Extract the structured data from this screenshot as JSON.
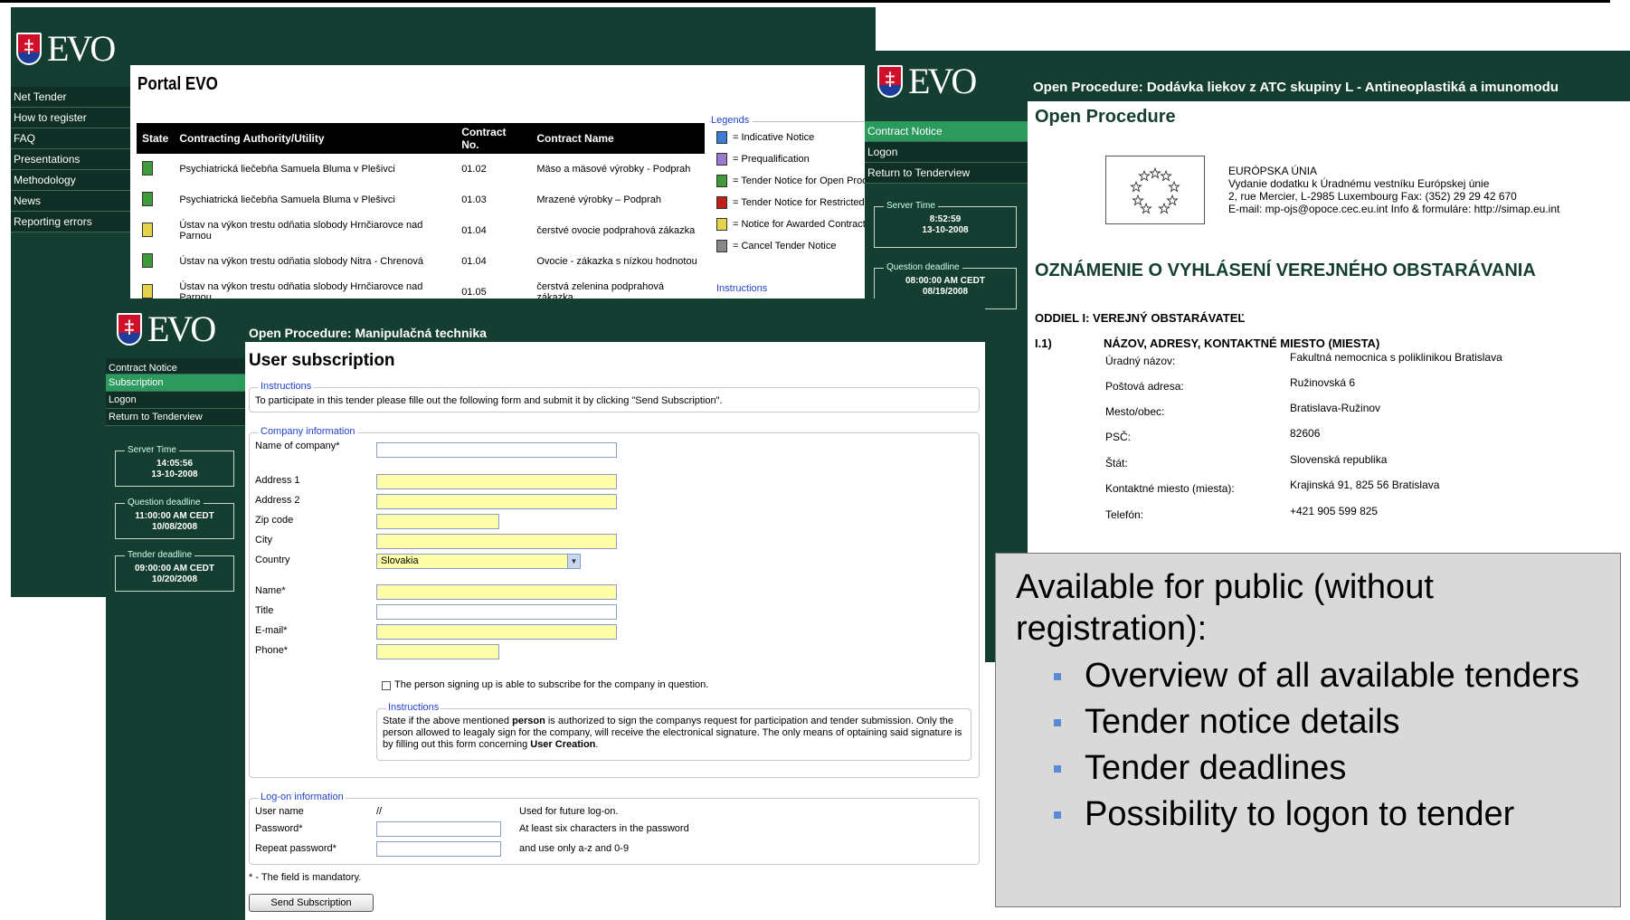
{
  "brand": {
    "logo_text": "EVO"
  },
  "portal": {
    "title": "Portal EVO",
    "menu": [
      "Net Tender",
      "How to register",
      "FAQ",
      "Presentations",
      "Methodology",
      "News",
      "Reporting errors"
    ],
    "table": {
      "headers": [
        "State",
        "Contracting Authority/Utility",
        "Contract No.",
        "Contract Name"
      ],
      "rows": [
        {
          "state": "green",
          "authority": "Psychiatrická liečebňa Samuela Bluma v Plešivci",
          "no": "01.02",
          "name": "Mäso a mäsové výrobky - Podprah"
        },
        {
          "state": "green",
          "authority": "Psychiatrická liečebňa Samuela Bluma v Plešivci",
          "no": "01.03",
          "name": "Mrazené výrobky – Podprah"
        },
        {
          "state": "yellow",
          "authority": "Ústav na výkon trestu odňatia slobody Hrnčiarovce nad Parnou",
          "no": "01.04",
          "name": "čerstvé ovocie podprahová zákazka"
        },
        {
          "state": "green",
          "authority": "Ústav na výkon trestu odňatia slobody Nitra - Chrenová",
          "no": "01.04",
          "name": "Ovocie - zákazka s nízkou hodnotou"
        },
        {
          "state": "yellow",
          "authority": "Ústav na výkon trestu odňatia slobody Hrnčiarovce nad Parnou",
          "no": "01.05",
          "name": "čerstvá zelenina podprahová zákazka"
        }
      ]
    },
    "legend": {
      "title": "Legends",
      "items": [
        {
          "label": "= Indicative Notice",
          "color": "#3a7bd5"
        },
        {
          "label": "= Prequalification",
          "color": "#9b7bd0"
        },
        {
          "label": "= Tender Notice for Open Proce",
          "color": "#3f9a3c"
        },
        {
          "label": "= Tender Notice for Restricted P",
          "color": "#c0201a"
        },
        {
          "label": "= Notice for Awarded Contract",
          "color": "#e4d44b"
        },
        {
          "label": "= Cancel Tender Notice",
          "color": "#888888"
        }
      ],
      "instructions": "Instructions"
    }
  },
  "open_procedure": {
    "window_title": "Open Procedure: Dodávka liekov z ATC skupiny L - Antineoplastiká a imunomodu",
    "heading": "Open Procedure",
    "menu": [
      "Contract Notice",
      "Logon",
      "Return to Tenderview"
    ],
    "server_time": {
      "label": "Server Time",
      "time": "8:52:59",
      "date": "13-10-2008"
    },
    "question_deadline": {
      "label": "Question deadline",
      "time": "08:00:00 AM CEDT",
      "date": "08/19/2008"
    },
    "eu_info": [
      "EURÓPSKA ÚNIA",
      "Vydanie dodatku k Úradnému vestníku Európskej únie",
      "2, rue Mercier, L-2985 Luxembourg Fax: (352) 29 29 42 670",
      "E-mail: mp-ojs@opoce.cec.eu.int Info & formuláre: http://simap.eu.int"
    ],
    "notice_title": "OZNÁMENIE O VYHLÁSENÍ VEREJNÉHO OBSTARÁVANIA",
    "section": "ODDIEL I: VEREJNÝ OBSTARÁVATEĽ",
    "sub_num": "I.1)",
    "sub_title": "NÁZOV, ADRESY, KONTAKTNÉ MIESTO (MIESTA)",
    "fields": [
      {
        "k": "Úradný názov:",
        "v": "Fakultná nemocnica s poliklinikou Bratislava"
      },
      {
        "k": "Poštová adresa:",
        "v": "Ružinovská 6"
      },
      {
        "k": "Mesto/obec:",
        "v": "Bratislava-Ružinov"
      },
      {
        "k": "PSČ:",
        "v": "82606"
      },
      {
        "k": "Štát:",
        "v": "Slovenská republika"
      },
      {
        "k": "Kontaktné miesto (miesta):",
        "v": "Krajinská 91, 825 56 Bratislava"
      },
      {
        "k": "Telefón:",
        "v": "+421 905 599 825"
      }
    ]
  },
  "subscription": {
    "window_title": "Open Procedure: Manipulačná technika",
    "heading": "User subscription",
    "menu": [
      "Contract Notice",
      "Subscription",
      "Logon",
      "Return to Tenderview"
    ],
    "server_time": {
      "label": "Server Time",
      "time": "14:05:56",
      "date": "13-10-2008"
    },
    "question_deadline": {
      "label": "Question deadline",
      "time": "11:00:00 AM CEDT",
      "date": "10/08/2008"
    },
    "tender_deadline": {
      "label": "Tender deadline",
      "time": "09:00:00 AM CEDT",
      "date": "10/20/2008"
    },
    "instructions": {
      "legend": "Instructions",
      "text": "To participate in this tender please fille out the following form and submit it by clicking \"Send Subscription\"."
    },
    "company": {
      "legend": "Company information",
      "fields": {
        "name_of_company": "Name of company*",
        "address1": "Address 1",
        "address2": "Address 2",
        "zip": "Zip code",
        "city": "City",
        "country": "Country",
        "name": "Name*",
        "title": "Title",
        "email": "E-mail*",
        "phone": "Phone*"
      },
      "country_value": "Slovakia",
      "checkbox_label": "The person signing up is able to subscribe for the company in question.",
      "inner_instructions_legend": "Instructions",
      "inner_instructions_1": "State if the above mentioned ",
      "inner_instructions_bold1": "person",
      "inner_instructions_2": " is authorized to sign the companys request for participation and tender submission. Only the person allowed to leagaly sign for the company, will receive the electronical signature. The only means of optaining said signature is by filling out this form concerning ",
      "inner_instructions_bold2": "User Creation",
      "inner_instructions_3": "."
    },
    "logon": {
      "legend": "Log-on information",
      "user_name": "User name",
      "user_value": "//",
      "user_hint": "Used for future log-on.",
      "password": "Password*",
      "password_hint": "At least six characters in the password",
      "repeat": "Repeat password*",
      "repeat_hint": "and use only a-z and 0-9"
    },
    "mandatory_note": "* - The field is mandatory.",
    "submit_label": "Send Subscription"
  },
  "callout": {
    "heading": "Available for public (without registration):",
    "items": [
      "Overview of all available tenders",
      "Tender notice details",
      "Tender deadlines",
      "Possibility to logon to tender"
    ]
  }
}
